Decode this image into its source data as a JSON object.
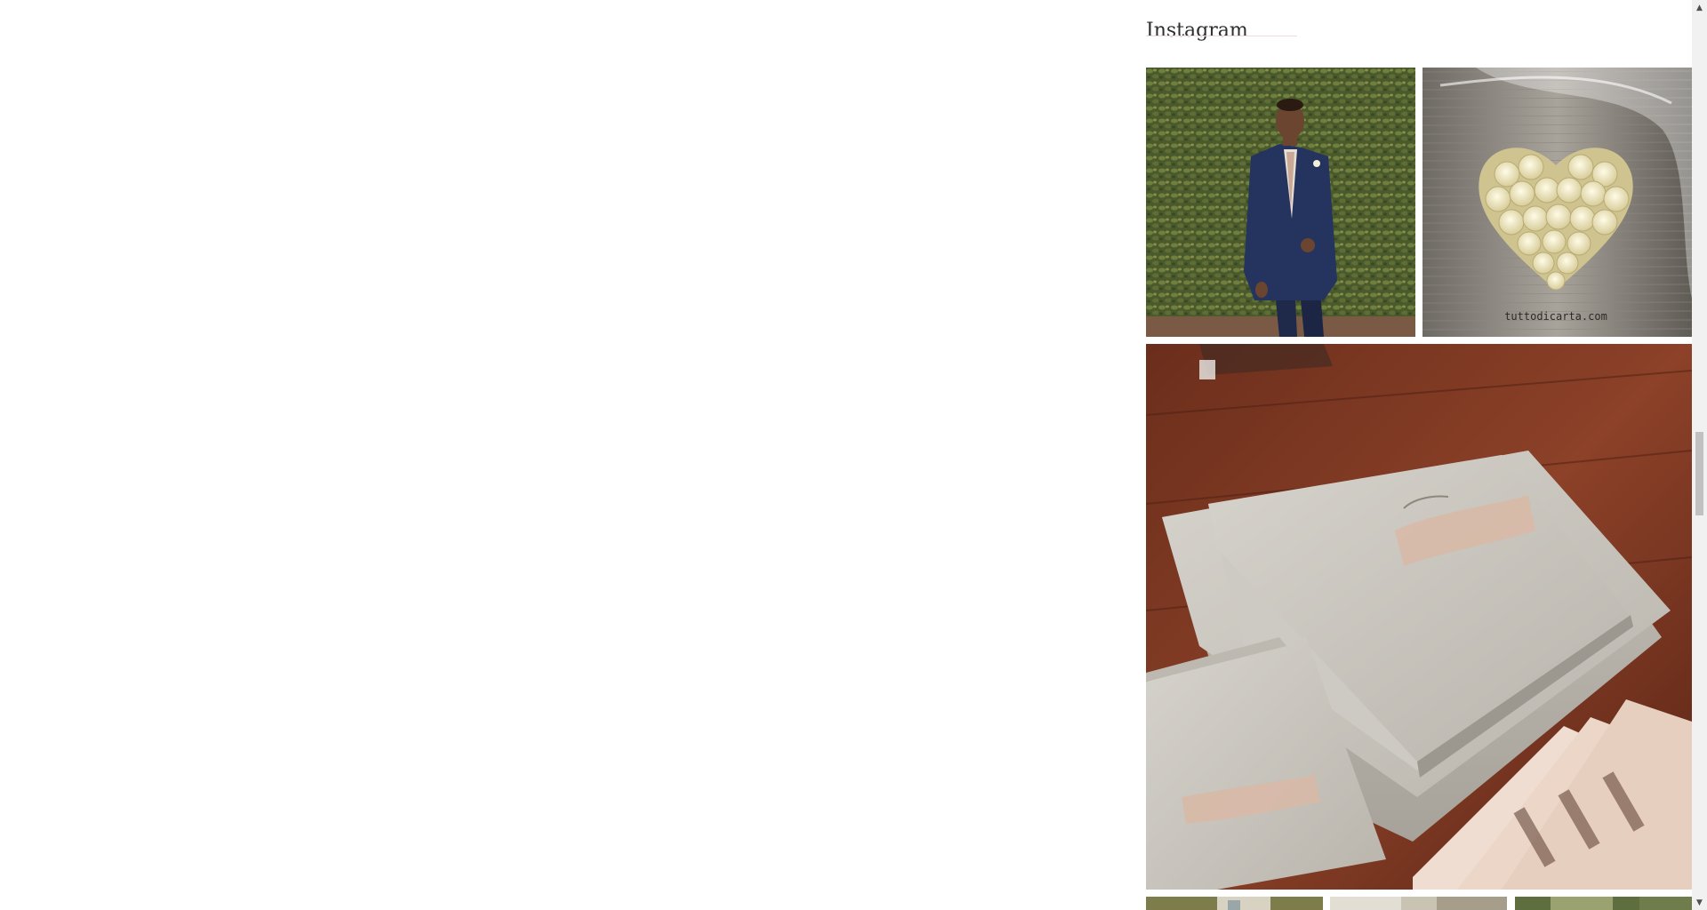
{
  "sidebar": {
    "instagram_title": "Instagram",
    "tiles": [
      {
        "alt": "groom-in-navy-suit-photo",
        "icon": "photo-thumbnail"
      },
      {
        "alt": "paper-rose-heart-photo",
        "icon": "photo-thumbnail",
        "watermark": "tuttodicarta.com"
      },
      {
        "alt": "wedding-album-boxes-photo",
        "icon": "photo-thumbnail"
      },
      {
        "alt": "photo-thumbnail"
      },
      {
        "alt": "photo-thumbnail"
      },
      {
        "alt": "photo-thumbnail"
      }
    ]
  },
  "scrollbar": {
    "up_glyph": "▲",
    "down_glyph": "▼"
  },
  "colors": {
    "title_text": "#2e2e2e",
    "title_rule": "#eadfdb",
    "scroll_track": "#f1f1f1",
    "scroll_thumb": "#c1c1c1"
  }
}
